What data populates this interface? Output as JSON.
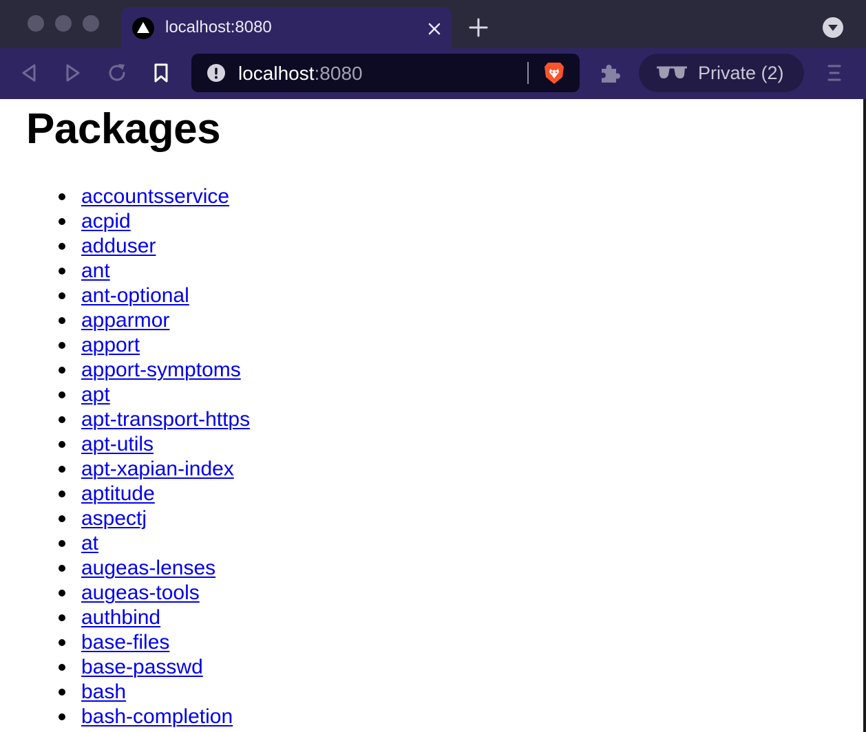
{
  "browser": {
    "tab": {
      "title": "localhost:8080"
    },
    "url": {
      "host": "localhost",
      "port": ":8080"
    },
    "private": {
      "label": "Private (2)"
    },
    "colors": {
      "tabstrip": "#2b2a3d",
      "toolbar": "#302563",
      "urlbar": "#0d0a24",
      "brave_orange": "#fb542b"
    },
    "icons": {
      "favicon": "triangle-logo-icon",
      "close": "close-icon",
      "new_tab": "plus-icon",
      "tab_menu": "chevron-down-icon",
      "back": "back-arrow-icon",
      "forward": "forward-arrow-icon",
      "reload": "reload-icon",
      "bookmark": "bookmark-icon",
      "site_info": "info-icon",
      "brave_shields": "brave-lion-icon",
      "extensions": "puzzle-icon",
      "private": "sunglasses-icon",
      "menu": "hamburger-menu-icon"
    }
  },
  "page": {
    "title": "Packages",
    "link_color": "#0000ee",
    "packages": [
      "accountsservice",
      "acpid",
      "adduser",
      "ant",
      "ant-optional",
      "apparmor",
      "apport",
      "apport-symptoms",
      "apt",
      "apt-transport-https",
      "apt-utils",
      "apt-xapian-index",
      "aptitude",
      "aspectj",
      "at",
      "augeas-lenses",
      "augeas-tools",
      "authbind",
      "base-files",
      "base-passwd",
      "bash",
      "bash-completion"
    ]
  }
}
